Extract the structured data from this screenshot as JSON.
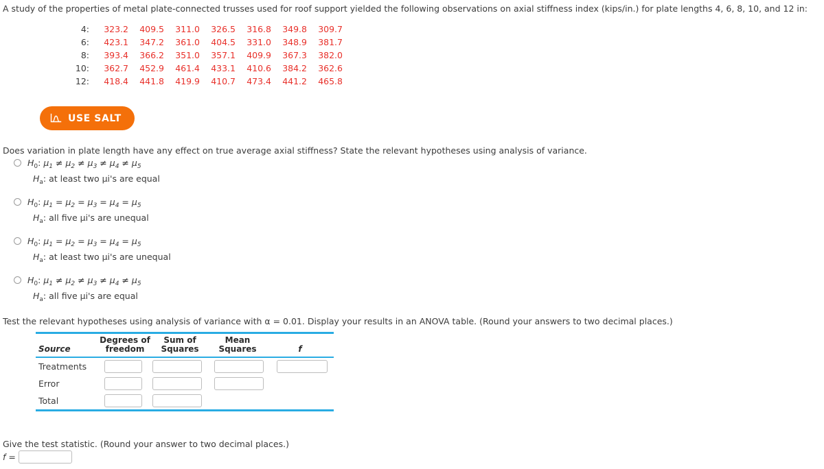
{
  "prompt": "A study of the properties of metal plate-connected trusses used for roof support yielded the following observations on axial stiffness index (kips/in.) for plate lengths 4, 6, 8, 10, and 12 in:",
  "data": {
    "rows": [
      {
        "label": "4:",
        "values": [
          "323.2",
          "409.5",
          "311.0",
          "326.5",
          "316.8",
          "349.8",
          "309.7"
        ]
      },
      {
        "label": "6:",
        "values": [
          "423.1",
          "347.2",
          "361.0",
          "404.5",
          "331.0",
          "348.9",
          "381.7"
        ]
      },
      {
        "label": "8:",
        "values": [
          "393.4",
          "366.2",
          "351.0",
          "357.1",
          "409.9",
          "367.3",
          "382.0"
        ]
      },
      {
        "label": "10:",
        "values": [
          "362.7",
          "452.9",
          "461.4",
          "433.1",
          "410.6",
          "384.2",
          "362.6"
        ]
      },
      {
        "label": "12:",
        "values": [
          "418.4",
          "441.8",
          "419.9",
          "410.7",
          "473.4",
          "441.2",
          "465.8"
        ]
      }
    ],
    "value_color": "#e8302a"
  },
  "salt_button": {
    "label": "USE SALT",
    "icon": "normal-curve-icon",
    "background": "#f4700a",
    "text_color": "#ffffff"
  },
  "question1": {
    "text": "Does variation in plate length have any effect on true average axial stiffness? State the relevant hypotheses using analysis of variance.",
    "options": [
      {
        "null_op": "≠",
        "alt_text": "at least two μi's are equal"
      },
      {
        "null_op": "=",
        "alt_text": "all five μi's are unequal"
      },
      {
        "null_op": "=",
        "alt_text": "at least two μi's are unequal"
      },
      {
        "null_op": "≠",
        "alt_text": "all five μi's are equal"
      }
    ],
    "selected": null
  },
  "question2": {
    "text": "Test the relevant hypotheses using analysis of variance with α = 0.01. Display your results in an ANOVA table. (Round your answers to two decimal places.)",
    "alpha": "0.01",
    "table": {
      "headers": [
        "Source",
        "Degrees of freedom",
        "Sum of Squares",
        "Mean Squares",
        "f"
      ],
      "header_parts": {
        "source": "Source",
        "df_line1": "Degrees of",
        "df_line2": "freedom",
        "ss_line1": "Sum of",
        "ss_line2": "Squares",
        "ms_line1": "Mean",
        "ms_line2": "Squares",
        "f": "f"
      },
      "rows": [
        {
          "label": "Treatments",
          "df": "",
          "ss": "",
          "ms": "",
          "f": ""
        },
        {
          "label": "Error",
          "df": "",
          "ss": "",
          "ms": ""
        },
        {
          "label": "Total",
          "df": "",
          "ss": ""
        }
      ],
      "rule_color": "#29ace3"
    }
  },
  "question3": {
    "text": "Give the test statistic. (Round your answer to two decimal places.)",
    "f_label": "f =",
    "f_value": ""
  }
}
